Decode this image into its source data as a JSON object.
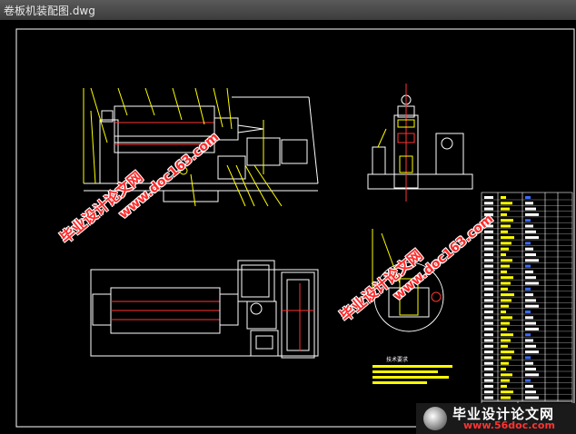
{
  "window": {
    "title": "卷板机装配图.dwg"
  },
  "watermarks": {
    "cn_text": "毕业设计论文网",
    "url_text": "www.doc163.com"
  },
  "footer": {
    "cn_text": "毕业设计论文网",
    "url_text": "www.56doc.com"
  },
  "drawing": {
    "tech_title": "技术要求",
    "colors": {
      "line": "#ffffff",
      "yellow": "#ffff00",
      "red": "#ff3333",
      "blue": "#3a6bff",
      "cyan": "#00ffff",
      "green": "#33ff33",
      "magenta": "#ff33ff"
    }
  }
}
